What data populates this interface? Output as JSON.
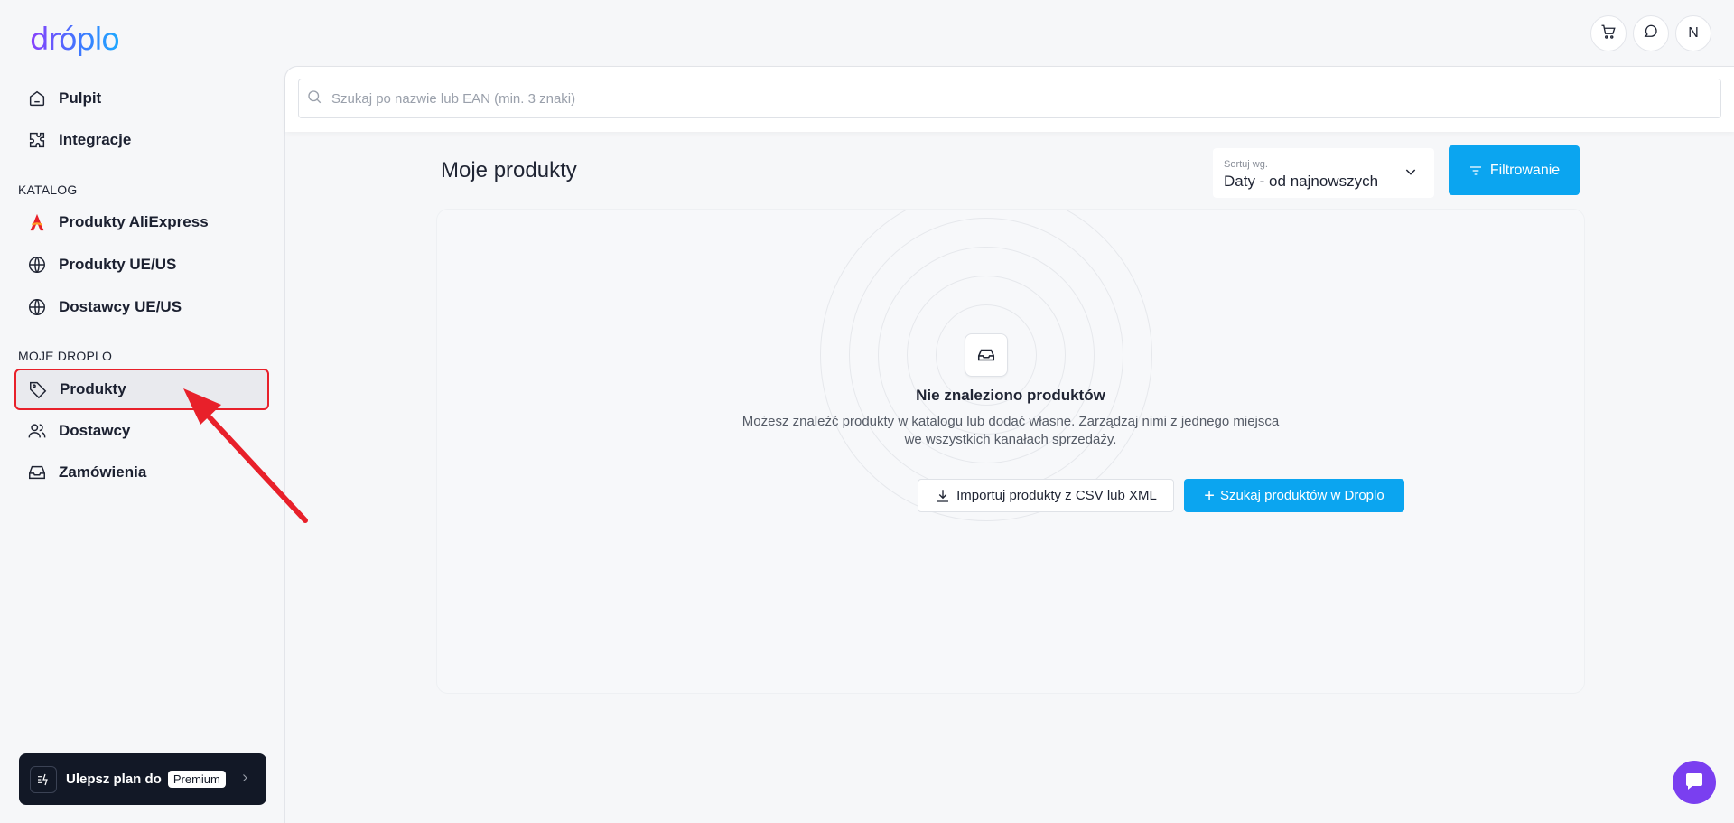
{
  "brand": {
    "logo_text": "dróplo"
  },
  "nav": {
    "top": [
      {
        "label": "Pulpit",
        "icon": "home-icon"
      },
      {
        "label": "Integracje",
        "icon": "puzzle-icon"
      }
    ],
    "katalog_label": "KATALOG",
    "katalog": [
      {
        "label": "Produkty AliExpress",
        "icon": "aliexpress-icon"
      },
      {
        "label": "Produkty UE/US",
        "icon": "globe-icon"
      },
      {
        "label": "Dostawcy UE/US",
        "icon": "globe-icon"
      }
    ],
    "moje_label": "MOJE DROPLO",
    "moje": [
      {
        "label": "Produkty",
        "icon": "tag-icon",
        "active": true
      },
      {
        "label": "Dostawcy",
        "icon": "users-icon"
      },
      {
        "label": "Zamówienia",
        "icon": "inbox-icon"
      }
    ]
  },
  "upgrade": {
    "label": "Ulepsz plan do",
    "badge": "Premium"
  },
  "topbar": {
    "avatar_initial": "N"
  },
  "search": {
    "placeholder": "Szukaj po nazwie lub EAN (min. 3 znaki)",
    "value": ""
  },
  "page": {
    "title": "Moje produkty"
  },
  "sort": {
    "caption": "Sortuj wg.",
    "selected": "Daty - od najnowszych"
  },
  "filter": {
    "label": "Filtrowanie"
  },
  "empty_state": {
    "title": "Nie znaleziono produktów",
    "description": "Możesz znaleźć produkty w katalogu lub dodać własne. Zarządzaj nimi z jednego miejsca we wszystkich kanałach sprzedaży.",
    "import_label": "Importuj produkty z CSV lub XML",
    "search_label": "Szukaj produktów w Droplo"
  },
  "colors": {
    "accent": "#0ba5f0",
    "highlight": "#e8202a",
    "chat": "#7a3ff0"
  }
}
